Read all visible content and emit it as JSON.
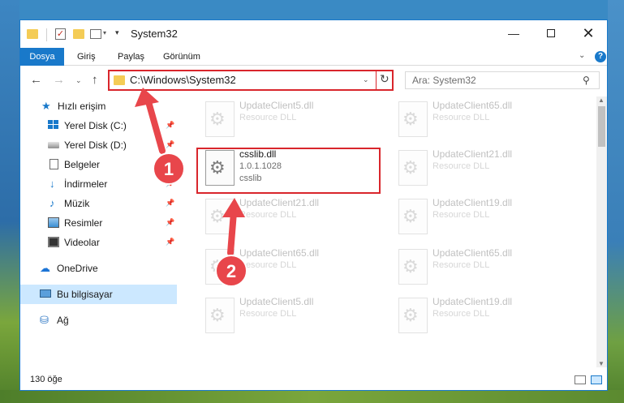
{
  "window": {
    "title": "System32",
    "minimize_glyph": "—",
    "close_glyph": "✕"
  },
  "ribbon": {
    "tabs": [
      {
        "label": "Dosya",
        "active": true
      },
      {
        "label": "Giriş"
      },
      {
        "label": "Paylaş"
      },
      {
        "label": "Görünüm"
      }
    ],
    "help_glyph": "?"
  },
  "address": {
    "path": "C:\\Windows\\System32",
    "search_placeholder": "Ara: System32"
  },
  "sidebar": {
    "items": [
      {
        "label": "Hızlı erişim",
        "icon": "star-icon",
        "pinned": false
      },
      {
        "label": "Yerel Disk (C:)",
        "icon": "windows-drive-icon",
        "pinned": true
      },
      {
        "label": "Yerel Disk (D:)",
        "icon": "drive-icon",
        "pinned": true
      },
      {
        "label": "Belgeler",
        "icon": "documents-icon",
        "pinned": true
      },
      {
        "label": "İndirmeler",
        "icon": "downloads-icon",
        "pinned": true
      },
      {
        "label": "Müzik",
        "icon": "music-icon",
        "pinned": true
      },
      {
        "label": "Resimler",
        "icon": "pictures-icon",
        "pinned": true
      },
      {
        "label": "Videolar",
        "icon": "videos-icon",
        "pinned": true
      },
      {
        "label": "OneDrive",
        "icon": "cloud-icon"
      },
      {
        "label": "Bu bilgisayar",
        "icon": "computer-icon",
        "selected": true
      },
      {
        "label": "Ağ",
        "icon": "network-icon"
      }
    ]
  },
  "files": {
    "highlighted": {
      "name": "csslib.dll",
      "version": "1.0.1.1028",
      "description": "csslib"
    },
    "left_column": [
      {
        "name": "UpdateClient5.dll",
        "desc": "Resource DLL"
      },
      {
        "name": "UpdateClient21.dll",
        "desc": "Resource DLL"
      },
      {
        "name": "UpdateClient65.dll",
        "desc": "Resource DLL"
      },
      {
        "name": "UpdateClient5.dll",
        "desc": "Resource DLL"
      }
    ],
    "right_column": [
      {
        "name": "UpdateClient65.dll",
        "desc": "Resource DLL"
      },
      {
        "name": "UpdateClient21.dll",
        "desc": "Resource DLL"
      },
      {
        "name": "UpdateClient19.dll",
        "desc": "Resource DLL"
      },
      {
        "name": "UpdateClient65.dll",
        "desc": "Resource DLL"
      },
      {
        "name": "UpdateClient19.dll",
        "desc": "Resource DLL"
      }
    ]
  },
  "status": {
    "item_count": "130 öğe"
  },
  "annotations": {
    "badge_1": "1",
    "badge_2": "2",
    "arrow_color": "#e8464b"
  }
}
